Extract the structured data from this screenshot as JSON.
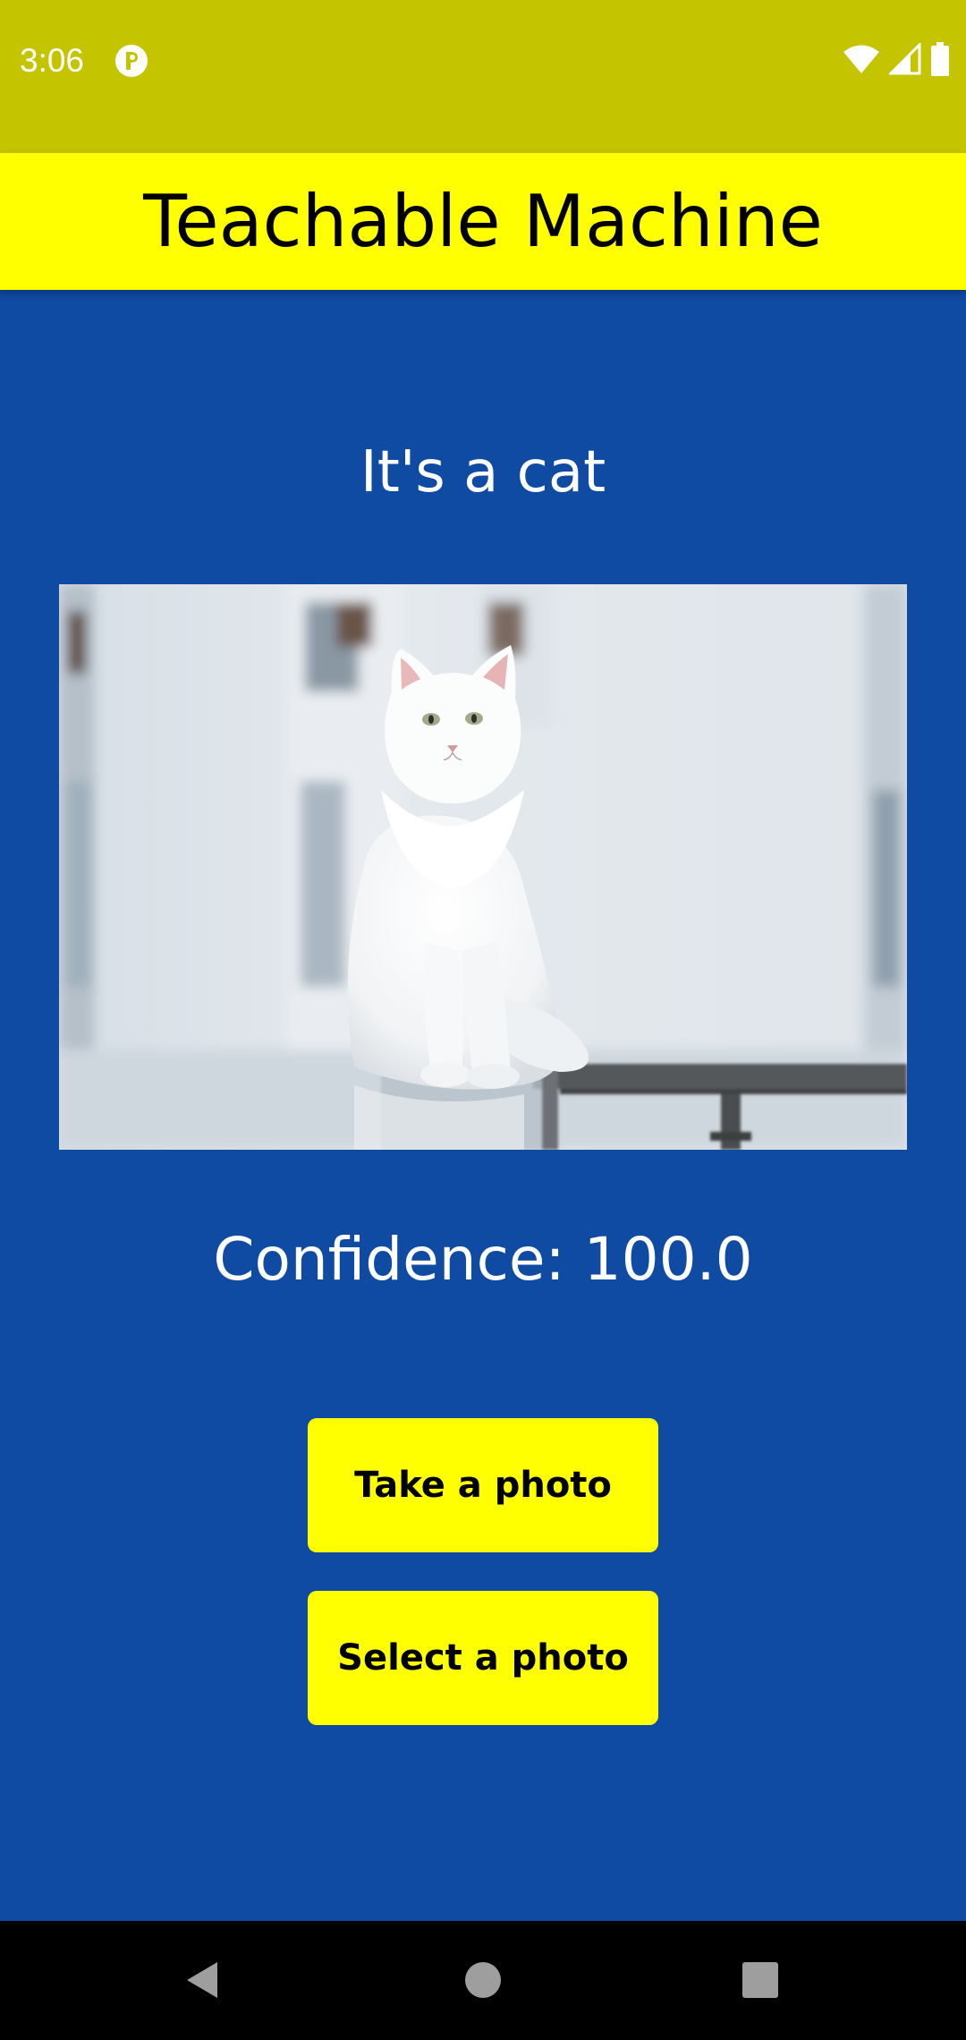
{
  "status_bar": {
    "time": "3:06",
    "icons": [
      "app-notification-icon",
      "wifi-icon",
      "signal-icon",
      "battery-icon"
    ]
  },
  "app_bar": {
    "title": "Teachable Machine"
  },
  "result": {
    "label": "It's a cat"
  },
  "photo": {
    "subject": "white cat"
  },
  "confidence": {
    "text": "Confidence: 100.0"
  },
  "buttons": {
    "take_photo": "Take a photo",
    "select_photo": "Select a photo"
  },
  "nav_bar": {
    "icons": [
      "back-icon",
      "home-icon",
      "recents-icon"
    ]
  },
  "colors": {
    "status_bar": "#c4c400",
    "app_bar": "#ffff00",
    "background": "#0f4aa3",
    "button": "#ffff00",
    "nav_bar": "#000000"
  }
}
